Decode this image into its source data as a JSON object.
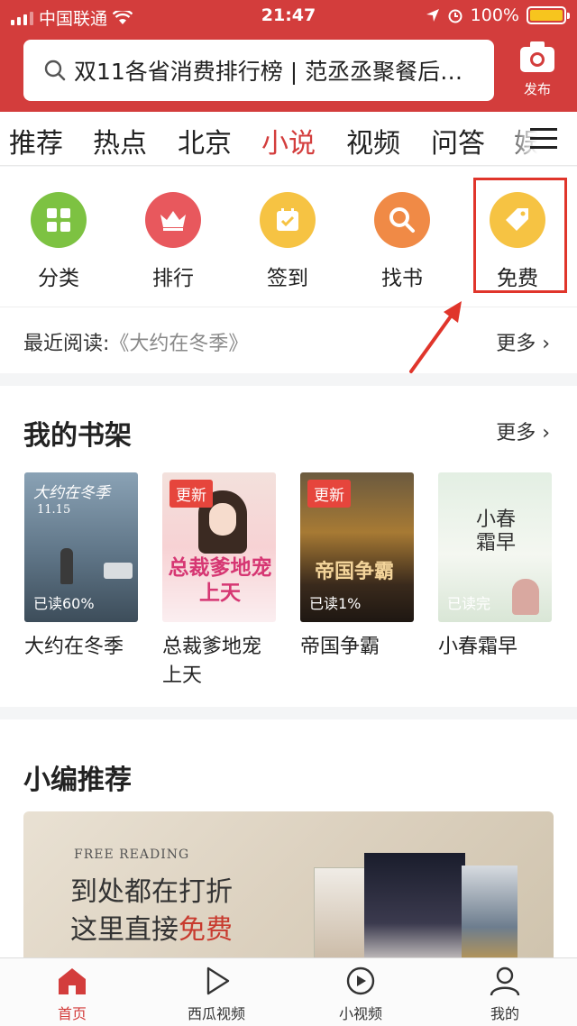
{
  "status_bar": {
    "carrier": "中国联通",
    "time": "21:47",
    "battery": "100%",
    "battery_level": 1.0
  },
  "header": {
    "search_text": "双11各省消费排行榜 | 范丞丞聚餐后…",
    "publish_label": "发布"
  },
  "tabs": [
    {
      "label": "推荐"
    },
    {
      "label": "热点"
    },
    {
      "label": "北京"
    },
    {
      "label": "小说",
      "active": true
    },
    {
      "label": "视频"
    },
    {
      "label": "问答"
    },
    {
      "label": "娱"
    }
  ],
  "quick_icons": [
    {
      "label": "分类",
      "icon": "grid-icon",
      "color": "#7dc242"
    },
    {
      "label": "排行",
      "icon": "crown-icon",
      "color": "#e8585d"
    },
    {
      "label": "签到",
      "icon": "calendar-check-icon",
      "color": "#f6c343"
    },
    {
      "label": "找书",
      "icon": "search-icon",
      "color": "#f08a46"
    },
    {
      "label": "免费",
      "icon": "tag-icon",
      "color": "#f6c343"
    }
  ],
  "recent": {
    "label": "最近阅读:",
    "book": "《大约在冬季》",
    "more": "更多"
  },
  "bookshelf": {
    "title": "我的书架",
    "more": "更多",
    "books": [
      {
        "title": "大约在冬季",
        "progress": "已读60%",
        "cover_text": "大约在冬季",
        "cover_date": "11.15"
      },
      {
        "title": "总裁爹地宠上天",
        "badge": "更新",
        "cover_text": "总裁爹地宠上天"
      },
      {
        "title": "帝国争霸",
        "badge": "更新",
        "progress": "已读1%",
        "cover_text": "帝国争霸"
      },
      {
        "title": "小春霜早",
        "progress": "已读完",
        "cover_text": "小春霜早"
      }
    ]
  },
  "picks": {
    "title": "小编推荐",
    "banner_en": "FREE READING",
    "banner_line1": "到处都在打折",
    "banner_line2_prefix": "这里直接",
    "banner_line2_highlight": "免费"
  },
  "bottom_nav": [
    {
      "label": "首页",
      "icon": "home-icon",
      "active": true
    },
    {
      "label": "西瓜视频",
      "icon": "play-icon"
    },
    {
      "label": "小视频",
      "icon": "short-video-icon"
    },
    {
      "label": "我的",
      "icon": "user-icon"
    }
  ],
  "colors": {
    "brand": "#d33d3c",
    "annotation": "#e0352b"
  }
}
